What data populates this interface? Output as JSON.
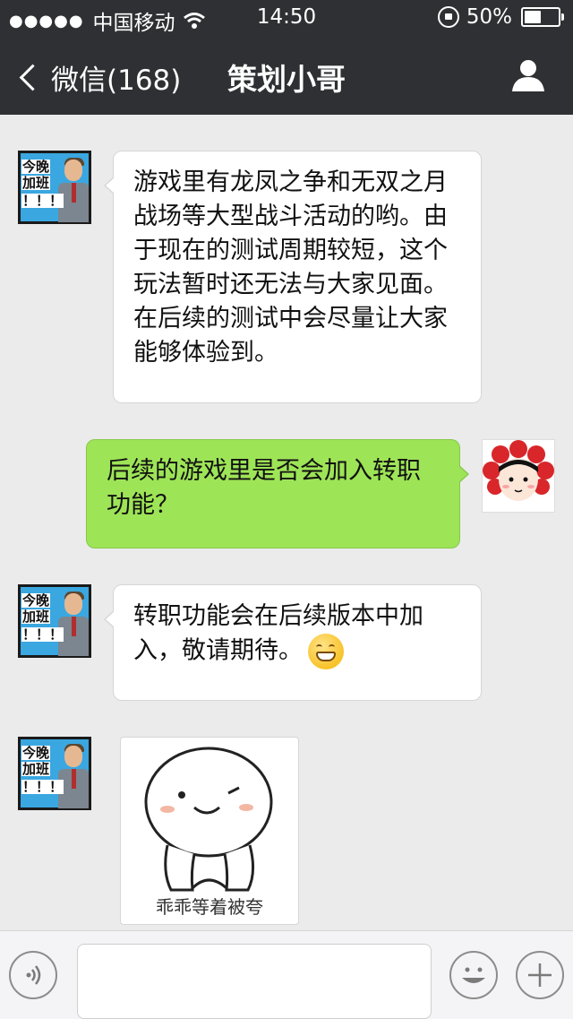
{
  "status_bar": {
    "signal": "●●●●●",
    "carrier": "中国移动",
    "time": "14:50",
    "battery_percent": "50%",
    "battery_level": 0.5
  },
  "nav": {
    "back_label": "微信(168)",
    "title": "策划小哥"
  },
  "messages": [
    {
      "sender": "other",
      "avatar_text": [
        "今晚",
        "加班",
        "！！！"
      ],
      "text": "游戏里有龙凤之争和无双之月战场等大型战斗活动的哟。由于现在的测试周期较短，这个玩法暂时还无法与大家见面。在后续的测试中会尽量让大家能够体验到。"
    },
    {
      "sender": "me",
      "text": "后续的游戏里是否会加入转职功能？"
    },
    {
      "sender": "other",
      "avatar_text": [
        "今晚",
        "加班",
        "！！！"
      ],
      "text": "转职功能会在后续版本中加入，敬请期待。",
      "emoji": "grinning-face"
    },
    {
      "sender": "other",
      "avatar_text": [
        "今晚",
        "加班",
        "！！！"
      ],
      "sticker_caption": "乖乖等着被夸"
    }
  ],
  "input_bar": {
    "voice_icon": "voice-icon",
    "emoji_icon": "smiley-icon",
    "plus_icon": "plus-icon",
    "value": ""
  },
  "colors": {
    "bar_bg": "#2e3033",
    "chat_bg": "#ebebeb",
    "my_bubble": "#9ee457",
    "other_bubble": "#ffffff"
  }
}
